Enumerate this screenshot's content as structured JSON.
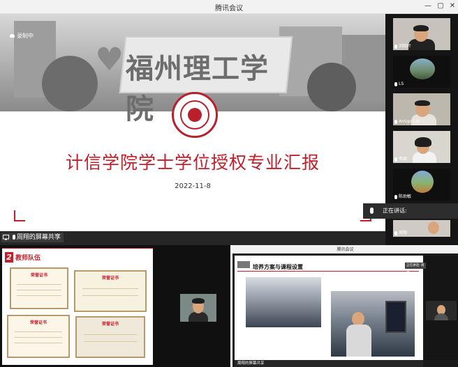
{
  "window": {
    "title": "腾讯会议",
    "minimize_glyph": "—",
    "maximize_glyph": "▢",
    "close_glyph": "✕"
  },
  "recording": {
    "label": "录制中"
  },
  "slide": {
    "sign_text": "福州理工学院",
    "title": "计信学院学士学位授权专业汇报",
    "date": "2022-11-8"
  },
  "share": {
    "label": "周翔的屏幕共享"
  },
  "participants": [
    {
      "name": "刘晓叶"
    },
    {
      "name": "LS"
    },
    {
      "name": "Amigo Lin"
    },
    {
      "name": "李颖"
    },
    {
      "name": "陈助敏"
    },
    {
      "name": "周翔"
    }
  ],
  "speaking": {
    "label": "正在讲话:"
  },
  "bottom_left": {
    "section_number": "2",
    "section_title": "教师队伍",
    "certificates": [
      "荣誉证书",
      "荣誉证书",
      "荣誉证书",
      "荣誉证书"
    ]
  },
  "bottom_right": {
    "title": "腾讯会议",
    "slide_heading": "培养方案与课程设置",
    "share_label": "周翔的屏幕共享",
    "speaking_label": "正在讲话: 周翔"
  },
  "colors": {
    "accent_red": "#c41e2b",
    "dark_bg": "#1f1f1f",
    "panel_bg": "#151515"
  }
}
